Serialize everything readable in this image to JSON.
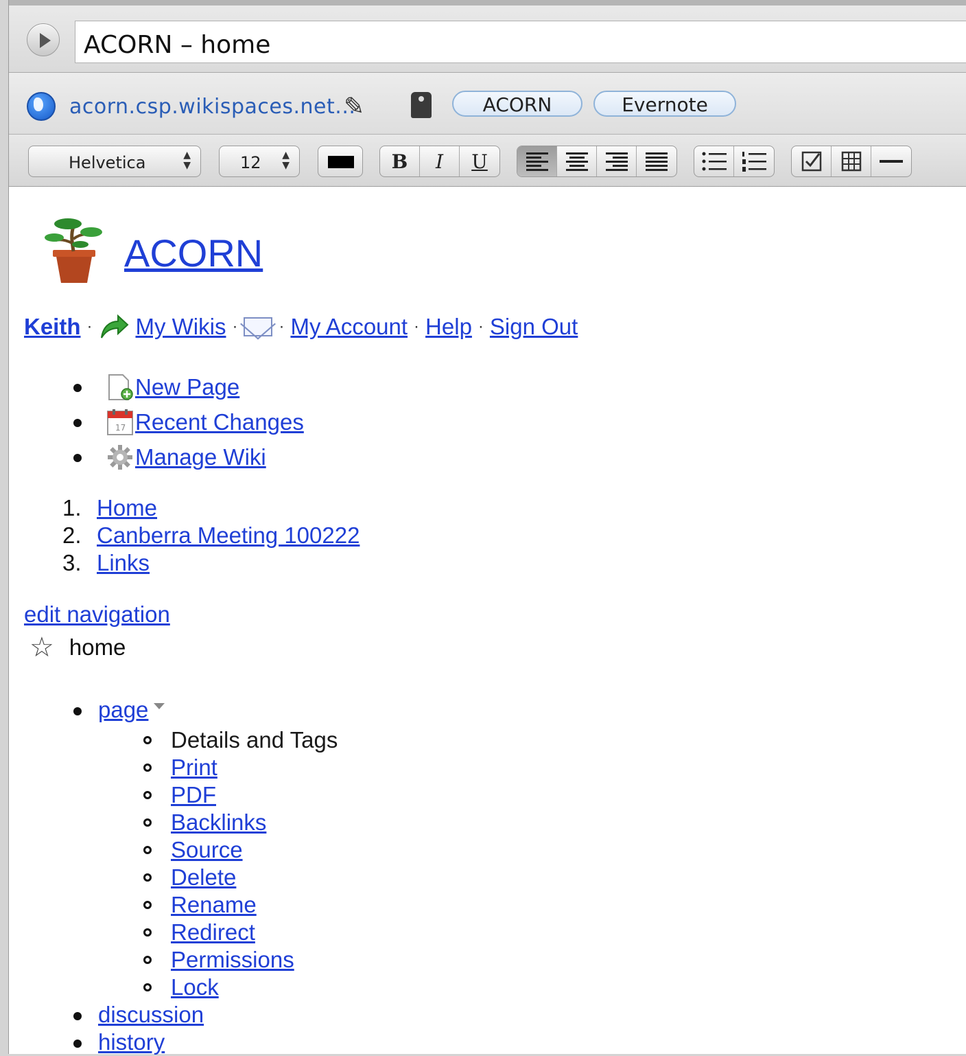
{
  "window": {
    "title": "ACORN – home"
  },
  "address": {
    "url": "acorn.csp.wikispaces.net...",
    "tags": [
      "ACORN",
      "Evernote"
    ]
  },
  "toolbar": {
    "font": "Helvetica",
    "size": "12",
    "bold": "B",
    "italic": "I",
    "underline": "U",
    "text_color": "#000000"
  },
  "page": {
    "site_title": "ACORN",
    "user": "Keith",
    "my_wikis": "My Wikis",
    "my_account": "My Account",
    "help": "Help",
    "sign_out": "Sign Out",
    "separator": "·",
    "actions": [
      "New Page",
      "Recent Changes",
      "Manage Wiki"
    ],
    "nav": [
      {
        "num": "1.",
        "label": "Home"
      },
      {
        "num": "2.",
        "label": "Canberra Meeting 100222"
      },
      {
        "num": "3.",
        "label": "Links"
      }
    ],
    "edit_navigation": "edit navigation",
    "page_name": "home",
    "menu": {
      "page": "page",
      "page_items": [
        "Details and Tags",
        "Print",
        "PDF",
        "Backlinks",
        "Source",
        "Delete",
        "Rename",
        "Redirect",
        "Permissions",
        "Lock"
      ],
      "discussion": "discussion",
      "history": "history"
    }
  },
  "colors": {
    "link": "#1f3fd6",
    "url_text": "#2a5db6"
  }
}
